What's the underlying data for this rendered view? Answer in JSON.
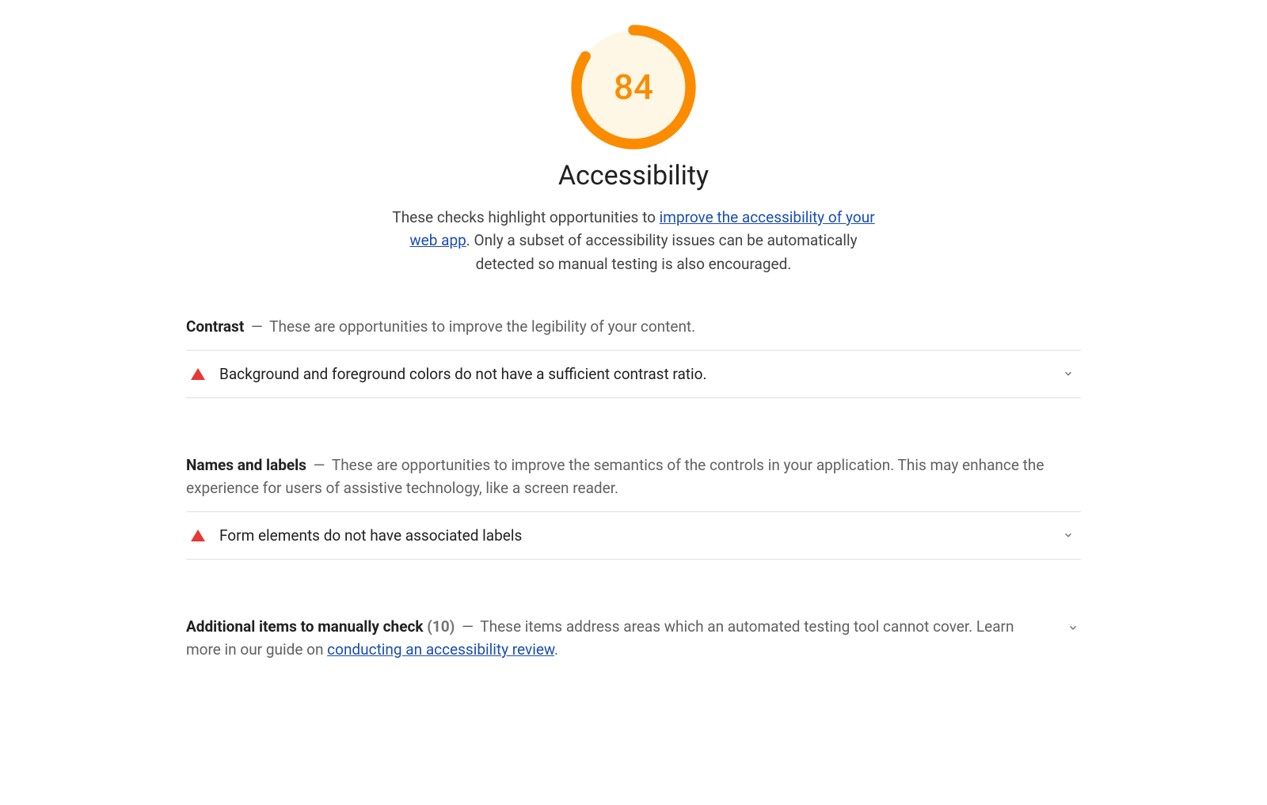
{
  "colors": {
    "score_stroke": "#fb8c00",
    "score_fill": "#fff5e0",
    "score_text": "#fb8c00",
    "fail_icon": "#e53935",
    "link": "#1a4db3"
  },
  "header": {
    "score": "84",
    "score_value": 84,
    "title": "Accessibility",
    "desc_prefix": "These checks highlight opportunities to ",
    "desc_link": "improve the accessibility of your web app",
    "desc_suffix": ". Only a subset of accessibility issues can be automatically detected so manual testing is also encouraged."
  },
  "groups": [
    {
      "id": "contrast",
      "title": "Contrast",
      "dash": "—",
      "desc": "These are opportunities to improve the legibility of your content.",
      "audits": [
        {
          "status": "fail",
          "title": "Background and foreground colors do not have a sufficient contrast ratio."
        }
      ]
    },
    {
      "id": "names-labels",
      "title": "Names and labels",
      "dash": "—",
      "desc": "These are opportunities to improve the semantics of the controls in your application. This may enhance the experience for users of assistive technology, like a screen reader.",
      "audits": [
        {
          "status": "fail",
          "title": "Form elements do not have associated labels"
        }
      ]
    }
  ],
  "manual": {
    "title": "Additional items to manually check",
    "count": "(10)",
    "dash": "—",
    "desc_prefix": "These items address areas which an automated testing tool cannot cover. Learn more in our guide on ",
    "desc_link": "conducting an accessibility review",
    "desc_suffix": "."
  }
}
